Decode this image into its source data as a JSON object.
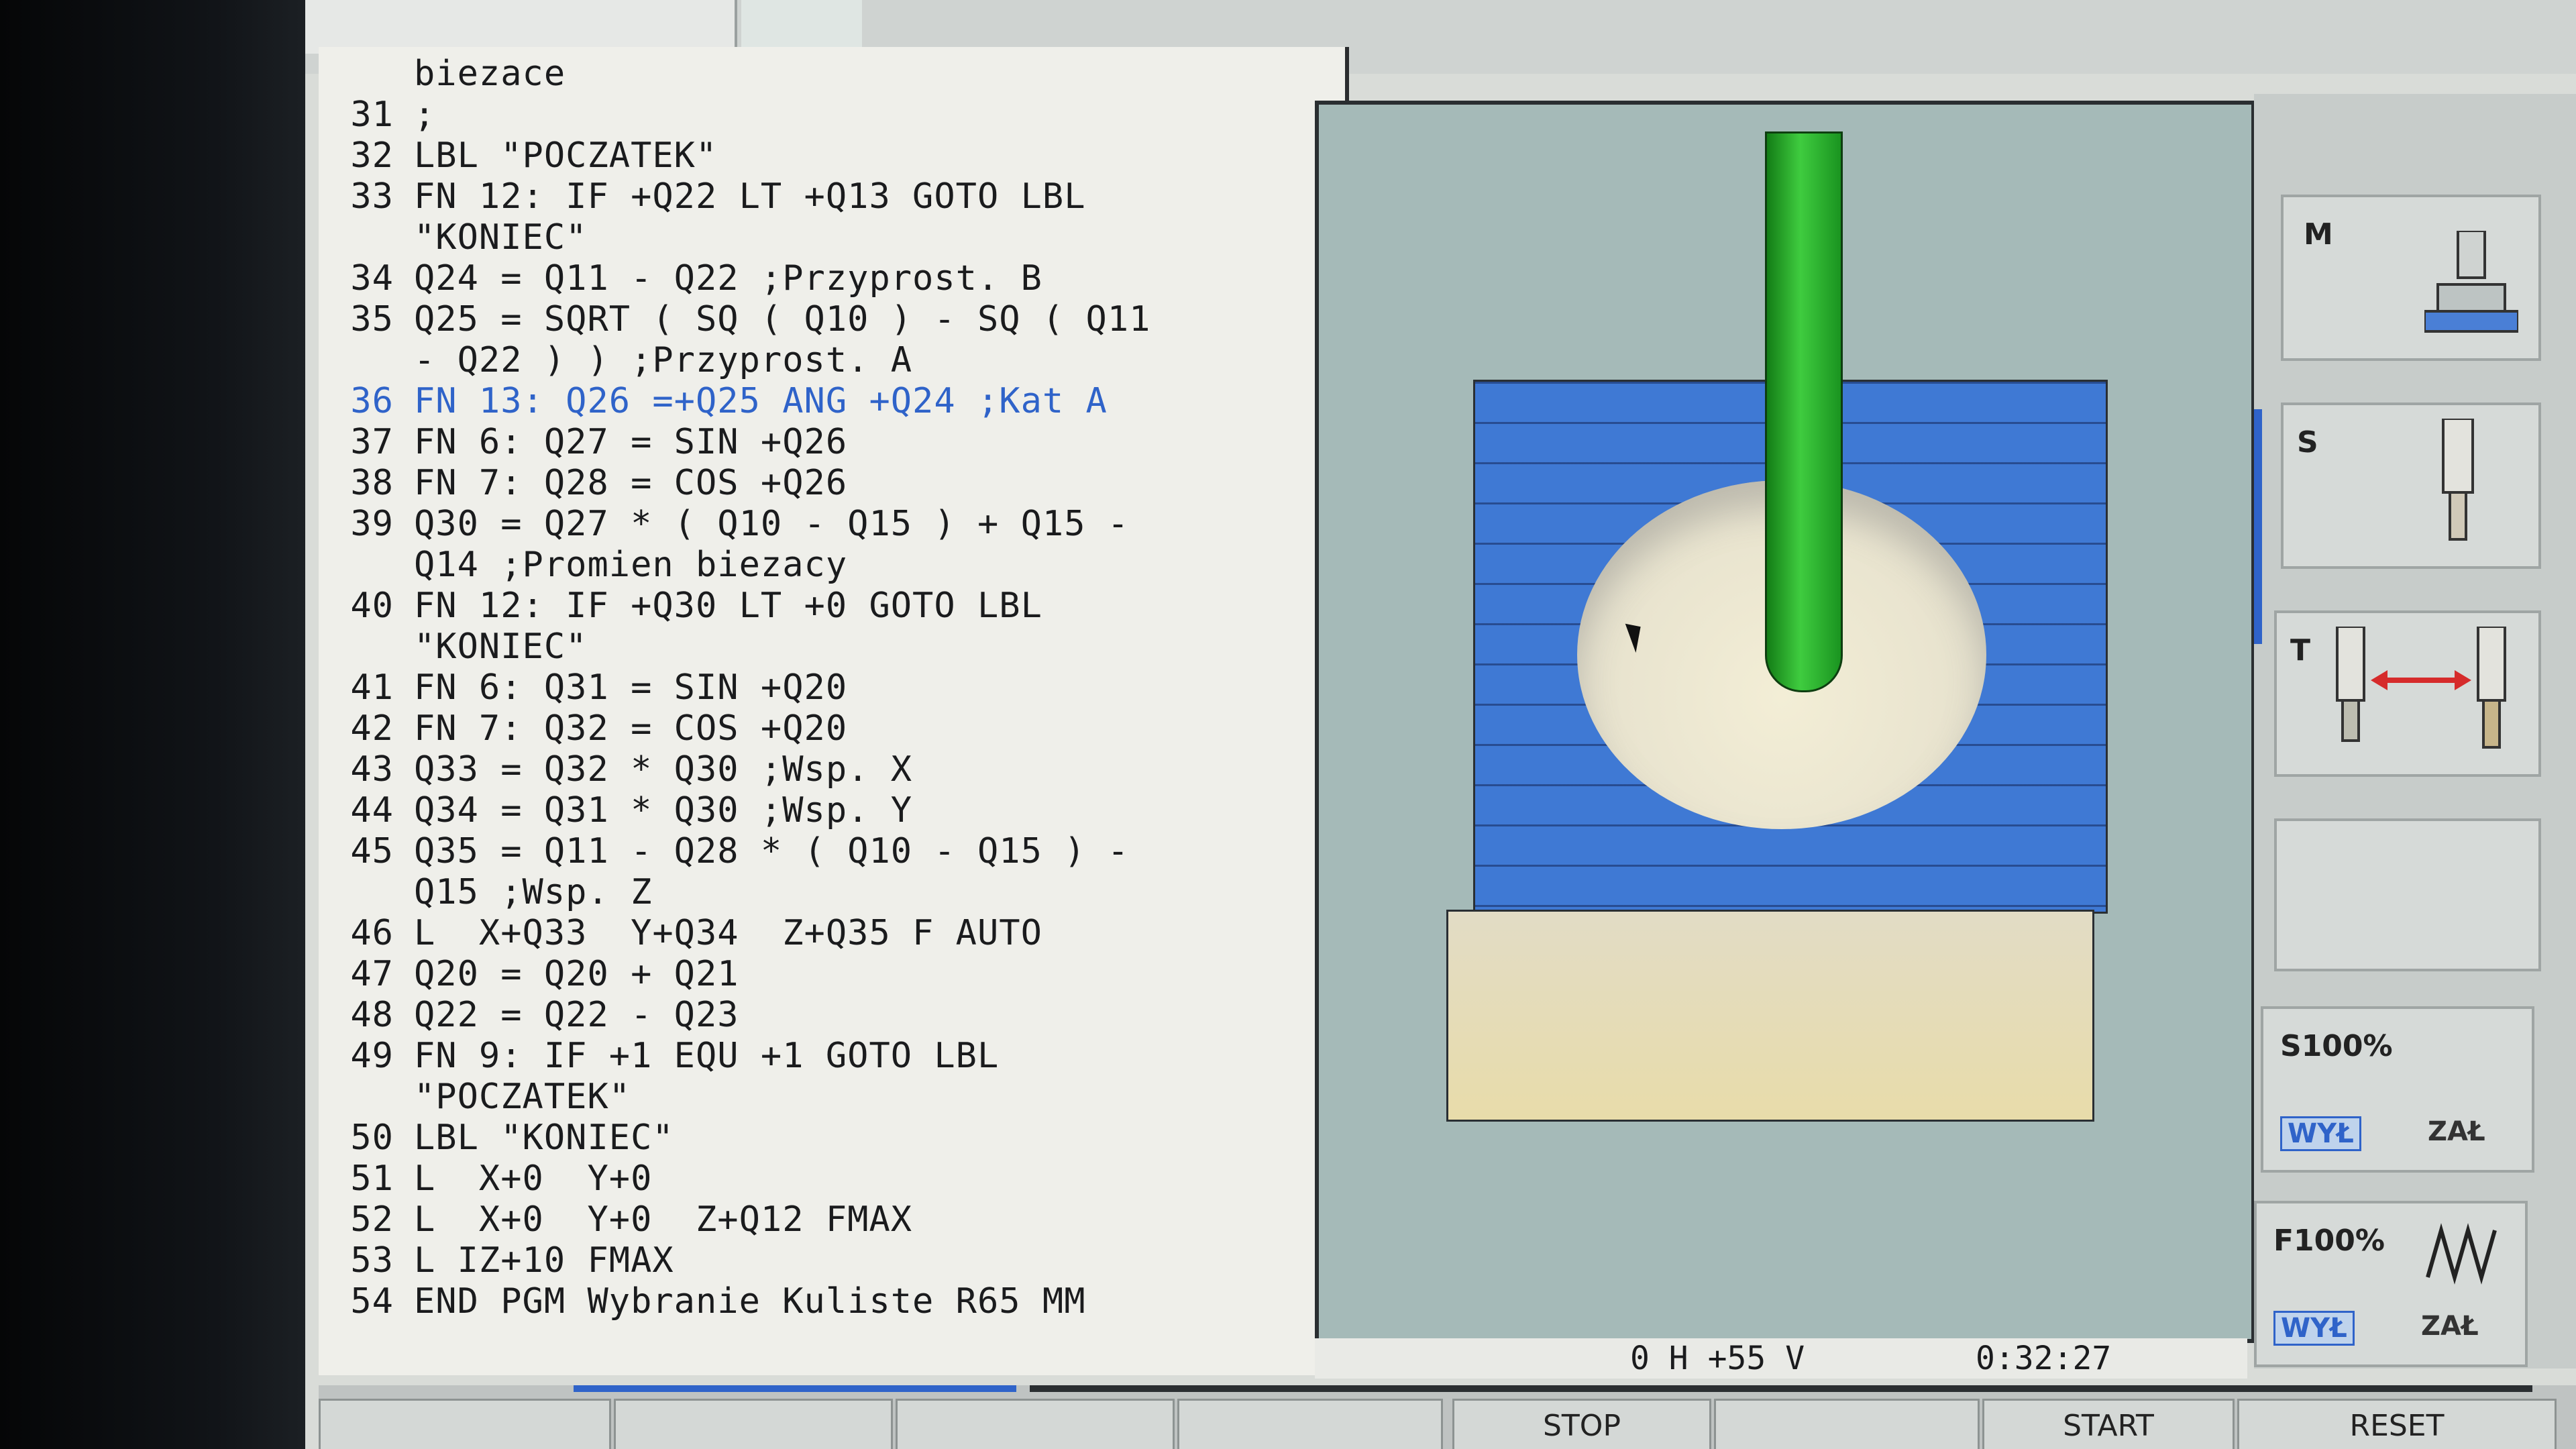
{
  "program": {
    "lines": [
      {
        "n": "",
        "text": "biezace"
      },
      {
        "n": "31",
        "text": ";"
      },
      {
        "n": "32",
        "text": "LBL \"POCZATEK\""
      },
      {
        "n": "33",
        "text": "FN 12: IF +Q22 LT +Q13 GOTO LBL"
      },
      {
        "n": "",
        "text": "\"KONIEC\""
      },
      {
        "n": "34",
        "text": "Q24 = Q11 - Q22 ;Przyprost. B"
      },
      {
        "n": "35",
        "text": "Q25 = SQRT ( SQ ( Q10 ) - SQ ( Q11"
      },
      {
        "n": "",
        "text": "- Q22 ) ) ;Przyprost. A"
      },
      {
        "n": "36",
        "text": "FN 13: Q26 =+Q25 ANG +Q24 ;Kat A"
      },
      {
        "n": "37",
        "text": "FN 6: Q27 = SIN +Q26"
      },
      {
        "n": "38",
        "text": "FN 7: Q28 = COS +Q26"
      },
      {
        "n": "39",
        "text": "Q30 = Q27 * ( Q10 - Q15 ) + Q15 -"
      },
      {
        "n": "",
        "text": "Q14 ;Promien biezacy"
      },
      {
        "n": "40",
        "text": "FN 12: IF +Q30 LT +0 GOTO LBL"
      },
      {
        "n": "",
        "text": "\"KONIEC\""
      },
      {
        "n": "41",
        "text": "FN 6: Q31 = SIN +Q20"
      },
      {
        "n": "42",
        "text": "FN 7: Q32 = COS +Q20"
      },
      {
        "n": "43",
        "text": "Q33 = Q32 * Q30 ;Wsp. X"
      },
      {
        "n": "44",
        "text": "Q34 = Q31 * Q30 ;Wsp. Y"
      },
      {
        "n": "45",
        "text": "Q35 = Q11 - Q28 * ( Q10 - Q15 ) -"
      },
      {
        "n": "",
        "text": "Q15 ;Wsp. Z"
      },
      {
        "n": "46",
        "text": "L  X+Q33  Y+Q34  Z+Q35 F AUTO"
      },
      {
        "n": "47",
        "text": "Q20 = Q20 + Q21"
      },
      {
        "n": "48",
        "text": "Q22 = Q22 - Q23"
      },
      {
        "n": "49",
        "text": "FN 9: IF +1 EQU +1 GOTO LBL"
      },
      {
        "n": "",
        "text": "\"POCZATEK\""
      },
      {
        "n": "50",
        "text": "LBL \"KONIEC\""
      },
      {
        "n": "51",
        "text": "L  X+0  Y+0"
      },
      {
        "n": "52",
        "text": "L  X+0  Y+0  Z+Q12 FMAX"
      },
      {
        "n": "53",
        "text": "L IZ+10 FMAX"
      },
      {
        "n": "54",
        "text": "END PGM Wybranie Kuliste R65 MM"
      }
    ]
  },
  "status": {
    "position": "0 H +55 V",
    "time": "0:32:27"
  },
  "side_panel": {
    "m_label": "M",
    "s_label": "S",
    "t_label": "T",
    "spindle_override": "S100%",
    "feed_override": "F100%",
    "off_label": "WYŁ",
    "on_label": "ZAŁ"
  },
  "softkeys": {
    "stop": "STOP",
    "start": "START",
    "reset": "RESET"
  },
  "colors": {
    "active_line": "#2f63c9",
    "stock": "#3f79d4",
    "tool": "#3fcc3f"
  }
}
